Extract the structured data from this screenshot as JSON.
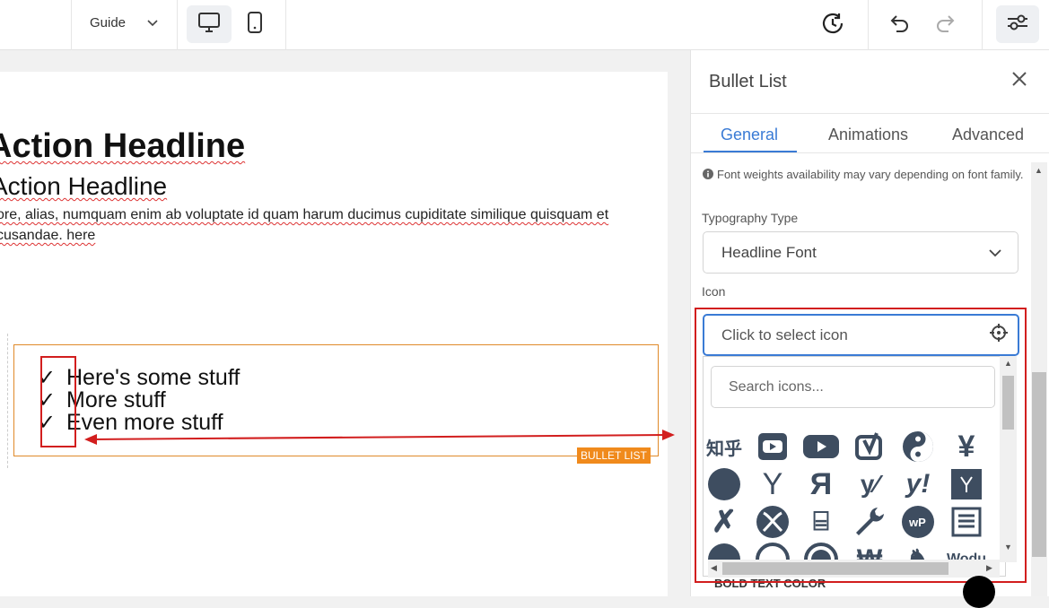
{
  "topbar": {
    "guide_label": "Guide"
  },
  "canvas": {
    "headline": "Action Headline",
    "subheadline": "Action Headline",
    "paragraph": "ore, alias, numquam enim ab voluptate id quam harum ducimus cupiditate similique quisquam et cusandae. here",
    "bullet_items": [
      {
        "check": "✓",
        "text": "Here's some stuff"
      },
      {
        "check": "✓",
        "text": "More stuff"
      },
      {
        "check": "✓",
        "text": "Even more stuff"
      }
    ],
    "widget_badge": "BULLET LIST"
  },
  "panel": {
    "title": "Bullet List",
    "tabs": [
      "General",
      "Animations",
      "Advanced"
    ],
    "active_tab": "General",
    "info_text": "Font weights availability may vary depending on font family.",
    "typography_label": "Typography Type",
    "typography_value": "Headline Font",
    "icon_label": "Icon",
    "icon_placeholder": "Click to select icon",
    "search_placeholder": "Search icons...",
    "bold_text_color_label": "BOLD TEXT COLOR"
  },
  "icon_grid": [
    "zhihu-icon",
    "youtube-square-icon",
    "youtube-icon",
    "yoast-icon",
    "yin-yang-icon",
    "yen-icon",
    "yelp-circle-icon",
    "y-combinator-icon",
    "yandex-icon",
    "yandex-international-icon",
    "yahoo-icon",
    "y-combinator-square-icon",
    "xing-icon",
    "xbox-icon",
    "xing-square-icon",
    "wrench-icon",
    "wpforms-icon",
    "wpexplorer-icon",
    "wpressr-icon",
    "wordpress-simple-icon",
    "wordpress-icon",
    "won-icon",
    "wolf-pack-icon",
    "wodu-icon"
  ],
  "colors": {
    "accent": "#3a7bd5",
    "highlight_red": "#d21e1e",
    "badge_orange": "#f08a1c",
    "icon_slate": "#3e4d60"
  }
}
